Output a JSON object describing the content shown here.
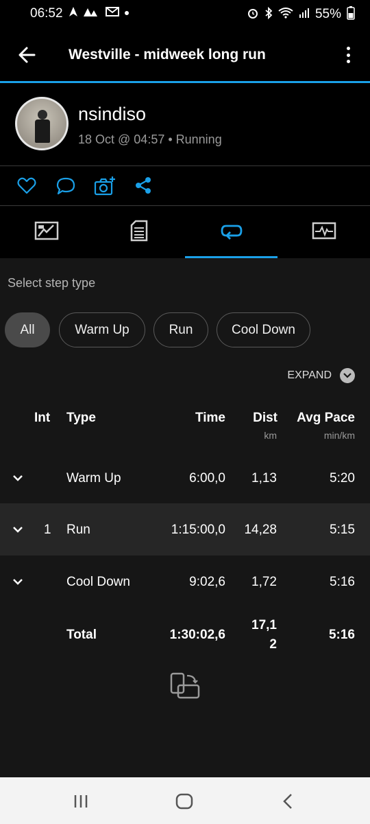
{
  "status_bar": {
    "time": "06:52",
    "battery": "55%",
    "icons": [
      "navigation-icon",
      "strava-icon",
      "gmail-icon",
      "notification-dot",
      "alarm-icon",
      "bluetooth-icon",
      "wifi-icon",
      "signal-icon",
      "battery-icon"
    ]
  },
  "header": {
    "title": "Westville - midweek long run"
  },
  "profile": {
    "username": "nsindiso",
    "meta": "18 Oct @ 04:57 • Running"
  },
  "actions": [
    "like-icon",
    "comment-icon",
    "add-photo-icon",
    "share-icon"
  ],
  "tabs": [
    {
      "name": "summary-tab",
      "icon": "chart-icon"
    },
    {
      "name": "details-tab",
      "icon": "document-icon"
    },
    {
      "name": "laps-tab",
      "icon": "repeat-icon",
      "active": true
    },
    {
      "name": "stats-tab",
      "icon": "pulse-icon"
    }
  ],
  "filter": {
    "label": "Select step type",
    "chips": [
      "All",
      "Warm Up",
      "Run",
      "Cool Down"
    ],
    "selected": "All"
  },
  "expand_label": "EXPAND",
  "table": {
    "headers": {
      "int": "Int",
      "type": "Type",
      "time": "Time",
      "dist": "Dist",
      "pace": "Avg Pace"
    },
    "units": {
      "dist": "km",
      "pace": "min/km"
    },
    "rows": [
      {
        "int": "",
        "type": "Warm Up",
        "time": "6:00,0",
        "dist": "1,13",
        "pace": "5:20"
      },
      {
        "int": "1",
        "type": "Run",
        "time": "1:15:00,0",
        "dist": "14,28",
        "pace": "5:15"
      },
      {
        "int": "",
        "type": "Cool Down",
        "time": "9:02,6",
        "dist": "1,72",
        "pace": "5:16"
      }
    ],
    "total": {
      "label": "Total",
      "time": "1:30:02,6",
      "dist_line1": "17,1",
      "dist_line2": "2",
      "pace": "5:16"
    }
  },
  "colors": {
    "accent": "#1aa0e8",
    "background": "#161616",
    "bar": "#000000"
  }
}
